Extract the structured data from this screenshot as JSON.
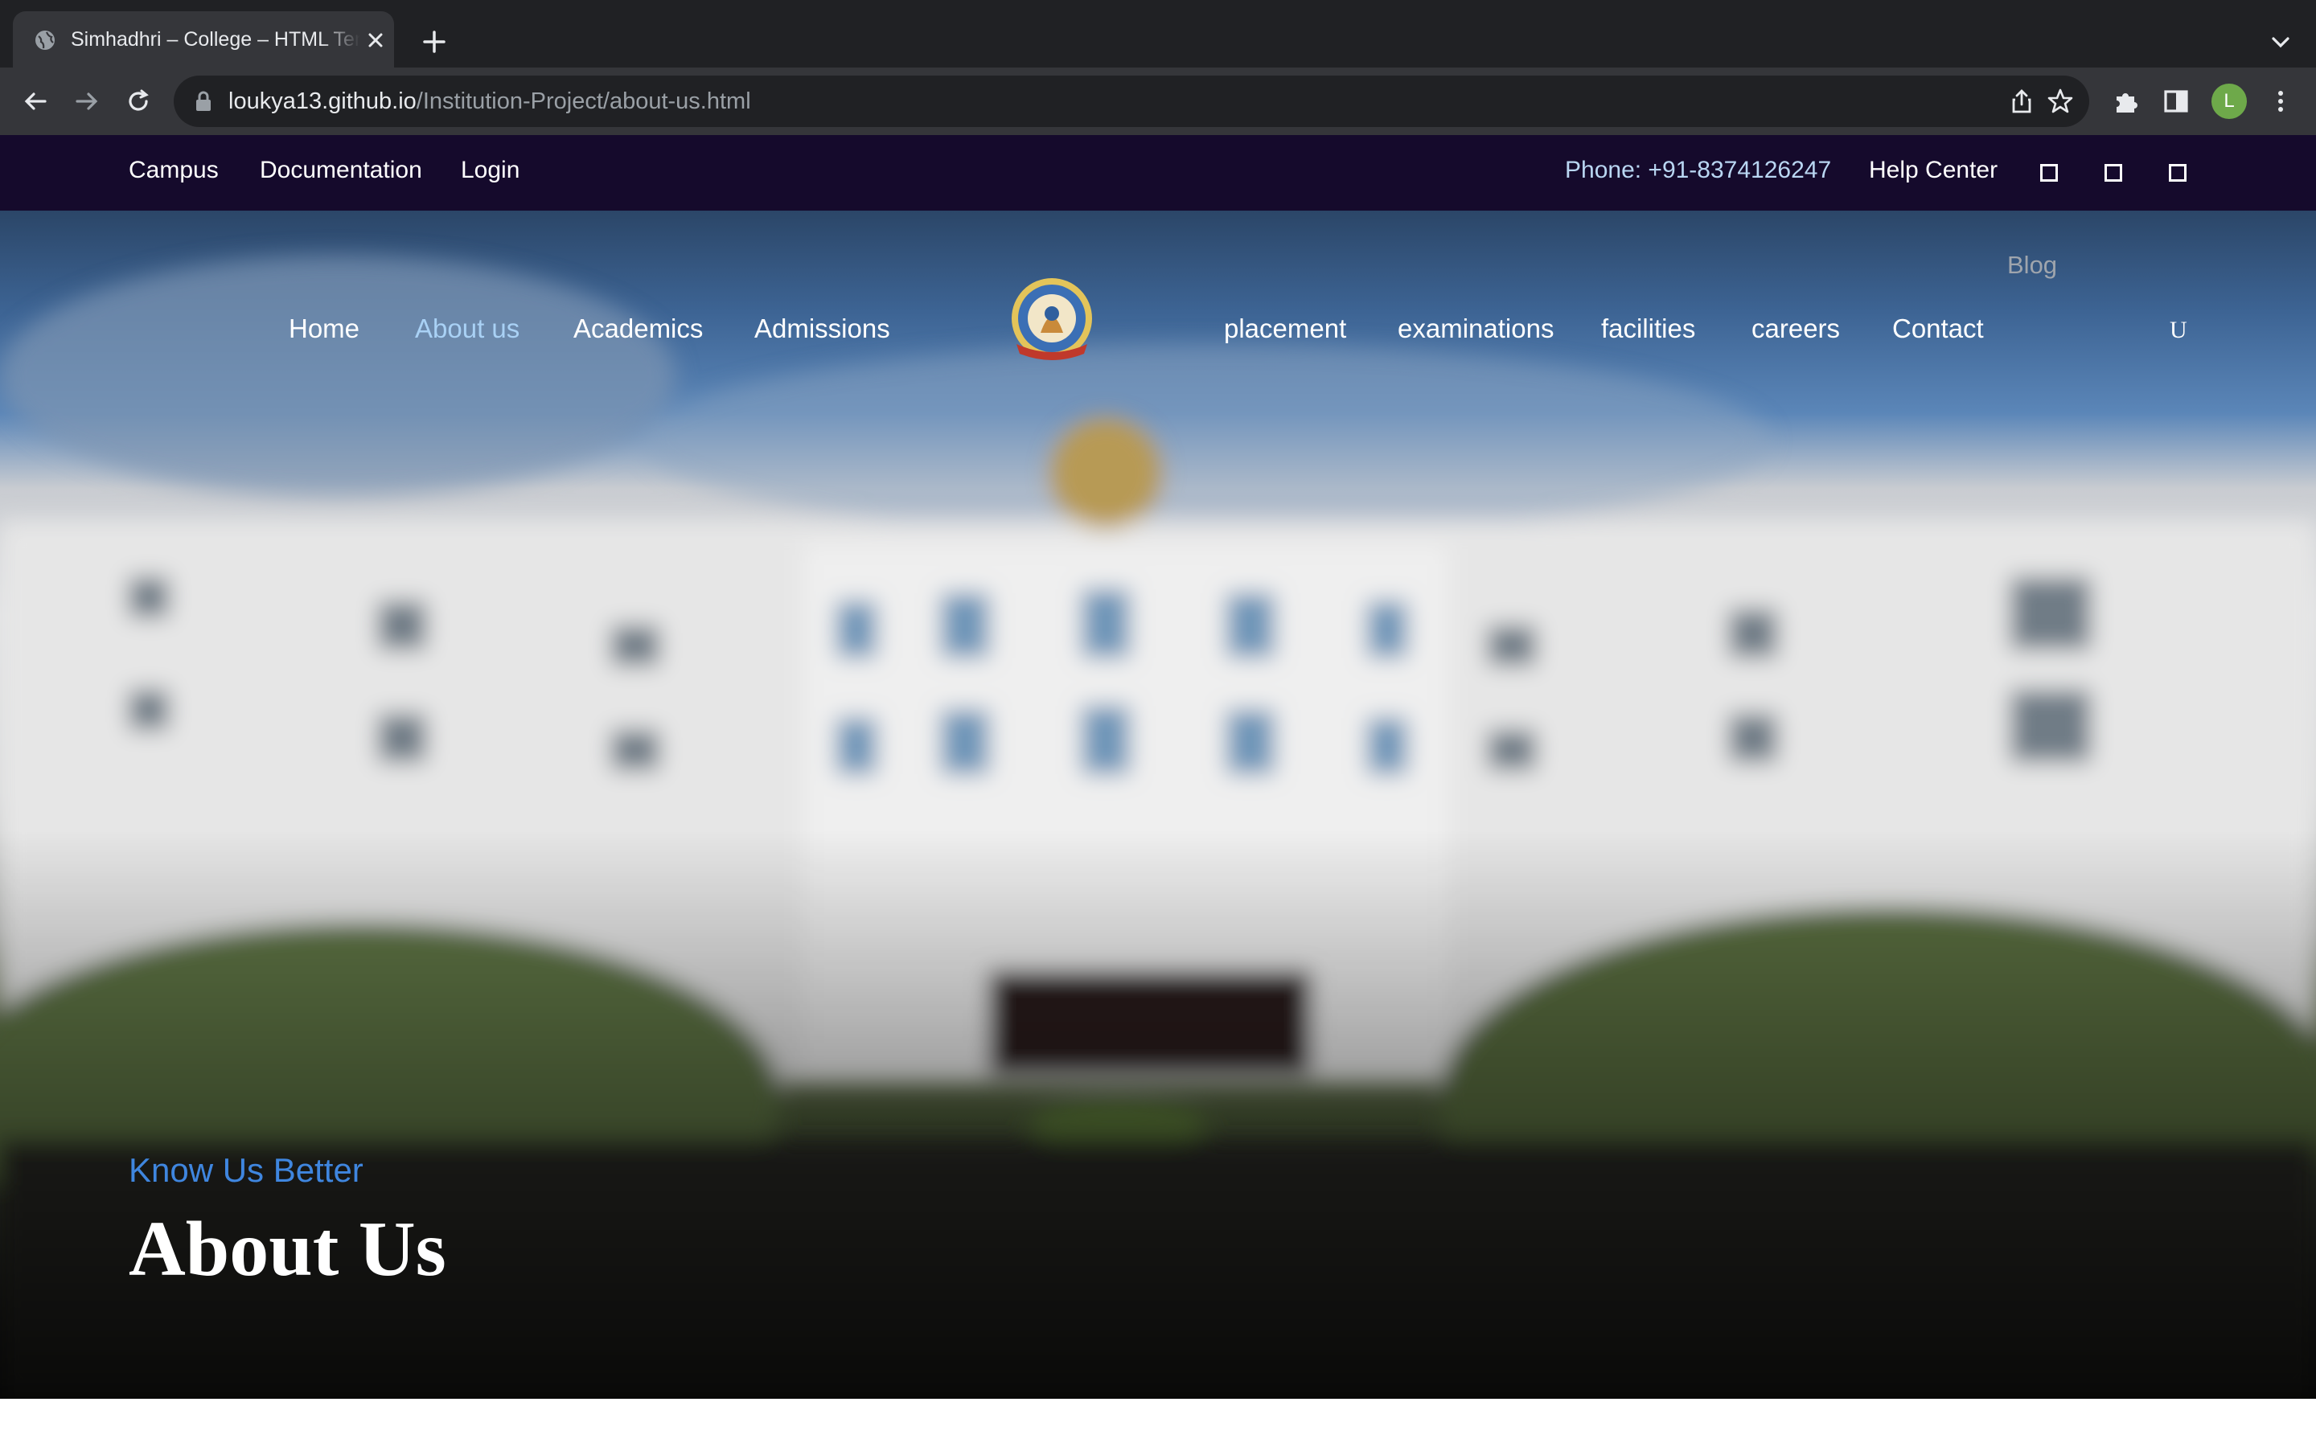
{
  "browser": {
    "tab_title": "Simhadhri – College – HTML Template",
    "url_domain": "loukya13.github.io",
    "url_path": "/Institution-Project/about-us.html",
    "profile_initial": "L"
  },
  "topbar": {
    "links": [
      "Campus",
      "Documentation",
      "Login"
    ],
    "phone": "Phone: +91-8374126247",
    "help": "Help Center",
    "social_icons": [
      "square-icon",
      "square-icon",
      "square-icon"
    ]
  },
  "nav": {
    "left": [
      "Home",
      "About us",
      "Academics",
      "Admissions"
    ],
    "right": [
      "placement",
      "examinations",
      "facilities",
      "careers",
      "Contact"
    ],
    "active": "About us",
    "blog": "Blog",
    "user_glyph": "U"
  },
  "hero": {
    "kicker": "Know Us Better",
    "title": "About Us"
  },
  "colors": {
    "topbar_bg": "#150a2c",
    "accent": "#3f86df",
    "active_nav": "#a9d1f5"
  }
}
